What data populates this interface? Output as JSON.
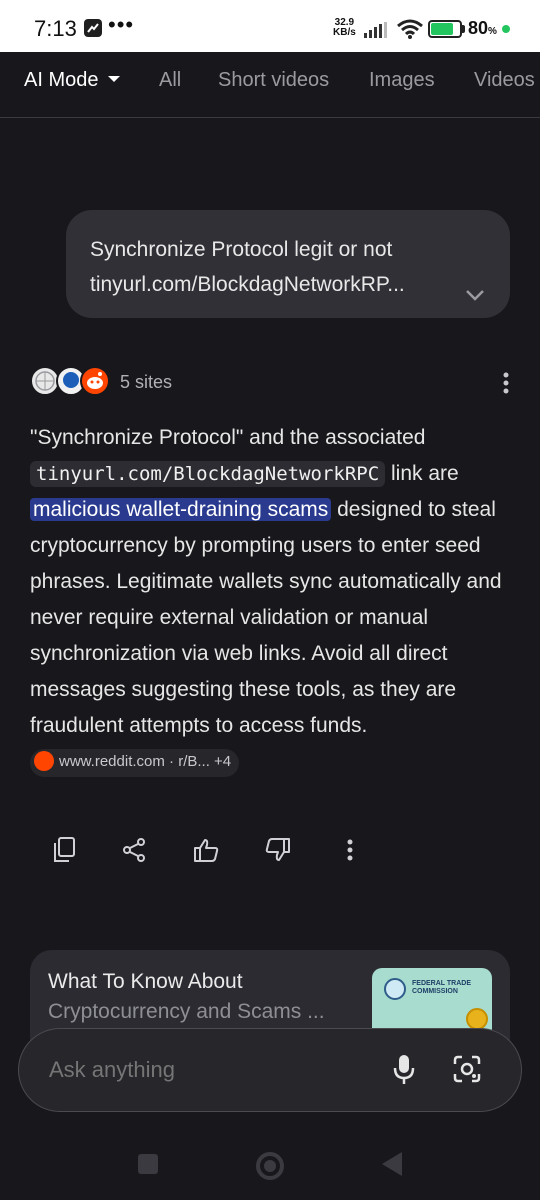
{
  "status_bar": {
    "time": "7:13",
    "more": "•••",
    "speed_value": "32.9",
    "speed_unit": "KB/s",
    "battery_percent": "80",
    "battery_pct_sign": "%",
    "battery_level": 0.8,
    "accent_color": "#22c55e"
  },
  "tabs": [
    {
      "label": "AI Mode",
      "active": true
    },
    {
      "label": "All"
    },
    {
      "label": "Short videos"
    },
    {
      "label": "Images"
    },
    {
      "label": "Videos"
    }
  ],
  "query": {
    "line1": "Synchronize Protocol legit or not",
    "line2": "tinyurl.com/BlockdagNetworkRP..."
  },
  "sources": {
    "label": "5 sites",
    "icons": [
      "globe-icon",
      "pin-icon",
      "reddit-icon"
    ]
  },
  "answer": {
    "part1": "\"Synchronize Protocol\" and the associated",
    "code": "tinyurl.com/BlockdagNetworkRPC",
    "part2": "link are",
    "highlight": "malicious wallet-draining scams",
    "part3": "designed to steal cryptocurrency by prompting users to enter seed phrases. Legitimate wallets sync automatically and never require external validation or manual synchronization via web links. Avoid all direct messages suggesting these tools, as they are fraudulent attempts to access funds.",
    "source_chip": "www.reddit.com · r/B...",
    "source_more": "+4",
    "highlight_color": "#2a3b8f"
  },
  "actions": [
    "copy-icon",
    "share-icon",
    "thumbs-up-icon",
    "thumbs-down-icon",
    "more-vertical-icon"
  ],
  "card": {
    "title": "What To Know About",
    "subtitle": "Cryptocurrency and Scams ...",
    "thumb_label_line1": "FEDERAL TRADE",
    "thumb_label_line2": "COMMISSION"
  },
  "search": {
    "placeholder": "Ask anything"
  }
}
